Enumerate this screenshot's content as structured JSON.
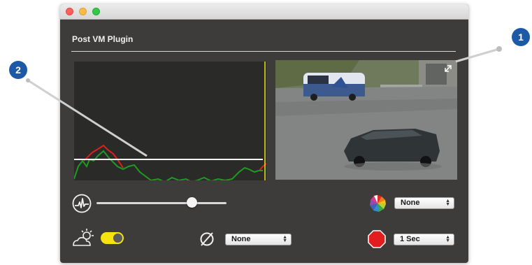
{
  "window": {
    "title": "Post VM Plugin"
  },
  "callouts": [
    {
      "label": "1"
    },
    {
      "label": "2"
    }
  ],
  "icons": {
    "threshold": "waveform-icon",
    "color": "color-wheel-icon",
    "weather": "sun-cloud-icon",
    "disable": "empty-set-icon",
    "stop": "stop-sign-icon",
    "expand": "expand-icon"
  },
  "controls": {
    "threshold_slider": {
      "value": 0.73
    },
    "color_select": {
      "value": "None"
    },
    "weather_toggle": {
      "on": true
    },
    "filter_select": {
      "value": "None"
    },
    "interval_select": {
      "value": "1 Sec"
    }
  },
  "colors": {
    "accent_yellow": "#f5e20e",
    "callout_blue": "#1c5aa8",
    "graph_red": "#e0201b",
    "graph_green": "#1f9a23",
    "stop_red": "#e31d1d"
  }
}
